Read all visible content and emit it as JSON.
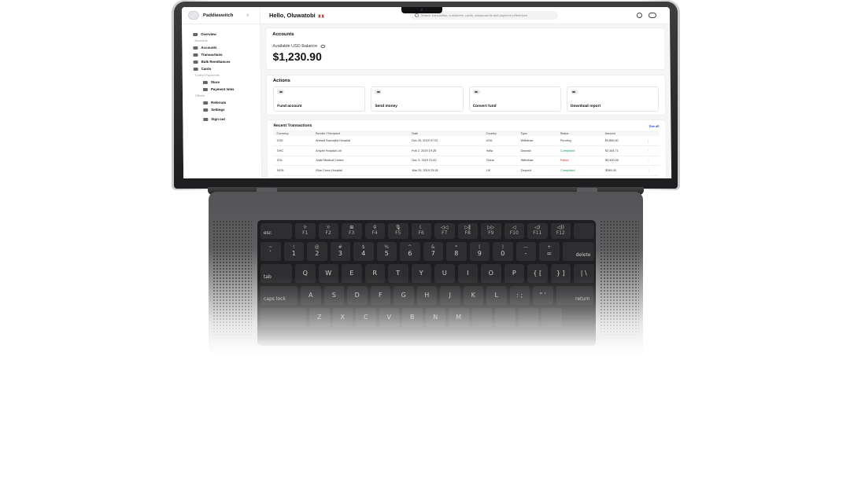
{
  "app": {
    "brand": "Paddieswitch",
    "greeting": "Hello, Oluwatobi",
    "search_placeholder": "Search transaction, customers, cards, subaccounts and payment references"
  },
  "sidebar": {
    "items": [
      {
        "label": "Overview",
        "icon": "grid-icon"
      },
      {
        "section": "Accounts"
      },
      {
        "label": "Accounts",
        "icon": "wallet-icon"
      },
      {
        "label": "Transactions",
        "icon": "card-icon"
      },
      {
        "label": "Bulk Remittances",
        "icon": "send-icon"
      },
      {
        "label": "Cards",
        "icon": "card-icon"
      },
      {
        "section": "Collect Payments"
      },
      {
        "label": "Store",
        "icon": "store-icon"
      },
      {
        "label": "Payment links",
        "icon": "link-icon"
      },
      {
        "section": "Others"
      },
      {
        "label": "Referrals",
        "icon": "users-icon"
      },
      {
        "label": "Settings",
        "icon": "gear-icon"
      },
      {
        "label": "Sign out",
        "icon": "logout-icon"
      }
    ]
  },
  "accounts": {
    "title": "Accounts",
    "balance_label": "Available USD Balance",
    "balance": "$1,230.90"
  },
  "actions": {
    "title": "Actions",
    "items": [
      "Fund account",
      "Send money",
      "Convert fund",
      "Download report"
    ]
  },
  "transactions": {
    "title": "Recent Transactions",
    "see_all": "See all",
    "columns": [
      "Currency",
      "Sender / Recipient",
      "Date",
      "Country",
      "Type",
      "Status",
      "Amount"
    ],
    "rows": [
      [
        "USD",
        "Ahmed Specialist Hospital",
        "Dec 20, 2019 07:52",
        "USA",
        "Withdraw",
        "Pending",
        "$4,800.00"
      ],
      [
        "GHC",
        "Aniyah Hospital Ltd",
        "Feb 2, 2019 19:28",
        "India",
        "Deposit",
        "Completed",
        "$2,444.71"
      ],
      [
        "ZOL",
        "Arabi Medical Centre",
        "Dec 3, 2019 21:42",
        "China",
        "Withdraw",
        "Failed",
        "$3,400.00"
      ],
      [
        "NGN",
        "Blue Cross Hospital",
        "Mar 20, 2019 23:18",
        "UK",
        "Deposit",
        "Completed",
        "$349.00"
      ],
      [
        "EUR",
        "First City Hospital",
        "Sep 7, 2019 23:52",
        "France",
        "Withdraw",
        "Completed",
        "$1,578.92"
      ]
    ]
  },
  "keyboard": {
    "fn_row": [
      {
        "top": "esc",
        "bottom": ""
      },
      {
        "top": "☼",
        "bottom": "F1"
      },
      {
        "top": "☼",
        "bottom": "F2"
      },
      {
        "top": "⊞",
        "bottom": "F3"
      },
      {
        "top": "⚲",
        "bottom": "F4"
      },
      {
        "top": "🎙",
        "bottom": "F5"
      },
      {
        "top": "☾",
        "bottom": "F6"
      },
      {
        "top": "◁◁",
        "bottom": "F7"
      },
      {
        "top": "▷‖",
        "bottom": "F8"
      },
      {
        "top": "▷▷",
        "bottom": "F9"
      },
      {
        "top": "◁",
        "bottom": "F10"
      },
      {
        "top": "◁)",
        "bottom": "F11"
      },
      {
        "top": "◁))",
        "bottom": "F12"
      },
      {
        "top": "",
        "bottom": ""
      }
    ],
    "num_row": [
      {
        "top": "~",
        "bottom": "`"
      },
      {
        "top": "!",
        "bottom": "1"
      },
      {
        "top": "@",
        "bottom": "2"
      },
      {
        "top": "#",
        "bottom": "3"
      },
      {
        "top": "$",
        "bottom": "4"
      },
      {
        "top": "%",
        "bottom": "5"
      },
      {
        "top": "^",
        "bottom": "6"
      },
      {
        "top": "&",
        "bottom": "7"
      },
      {
        "top": "*",
        "bottom": "8"
      },
      {
        "top": "(",
        "bottom": "9"
      },
      {
        "top": ")",
        "bottom": "0"
      },
      {
        "top": "—",
        "bottom": "-"
      },
      {
        "top": "+",
        "bottom": "="
      },
      {
        "top": "",
        "bottom": "delete"
      }
    ],
    "tab_row": [
      "tab",
      "Q",
      "W",
      "E",
      "R",
      "T",
      "Y",
      "U",
      "I",
      "O",
      "P",
      "{ [",
      "} ]",
      "| \\"
    ],
    "caps_row": [
      "caps lock",
      "A",
      "S",
      "D",
      "F",
      "G",
      "H",
      "J",
      "K",
      "L",
      ": ;",
      "\" '",
      "return"
    ],
    "shift_row": [
      "",
      "Z",
      "X",
      "C",
      "V",
      "B",
      "N",
      "M",
      "",
      "",
      "",
      ""
    ]
  }
}
